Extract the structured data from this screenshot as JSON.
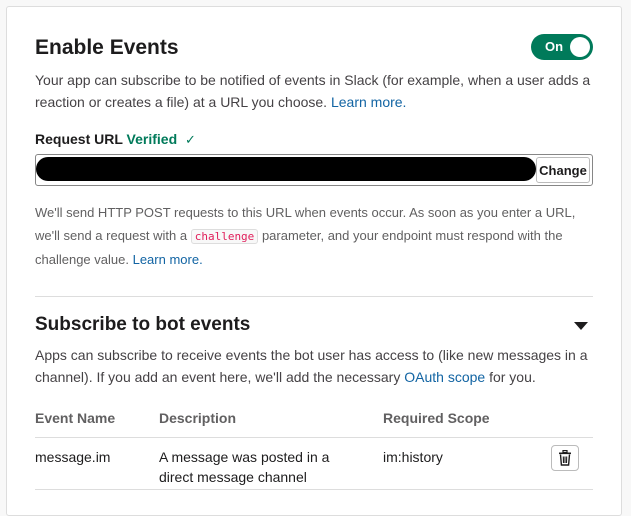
{
  "enable_events": {
    "title": "Enable Events",
    "toggle_label": "On",
    "description": "Your app can subscribe to be notified of events in Slack (for example, when a user adds a reaction or creates a file) at a URL you choose.",
    "learn_more": "Learn more."
  },
  "request_url": {
    "label": "Request URL",
    "status": "Verified",
    "status_icon": "check-icon",
    "value": "",
    "change_button": "Change",
    "help_part1": "We'll send HTTP POST requests to this URL when events occur. As soon as you enter a URL, we'll send a request with a",
    "help_code": "challenge",
    "help_part2": "parameter, and your endpoint must respond with the challenge value.",
    "learn_more": "Learn more."
  },
  "bot_events": {
    "title": "Subscribe to bot events",
    "description_part1": "Apps can subscribe to receive events the bot user has access to (like new messages in a channel). If you add an event here, we'll add the necessary",
    "oauth_link": "OAuth scope",
    "description_part2": "for you.",
    "columns": [
      "Event Name",
      "Description",
      "Required Scope"
    ],
    "rows": [
      {
        "event": "message.im",
        "description": "A message was posted in a direct message channel",
        "scope": "im:history"
      }
    ]
  },
  "colors": {
    "accent": "#007a5a",
    "link": "#1264a3",
    "code": "#e01e5a"
  }
}
